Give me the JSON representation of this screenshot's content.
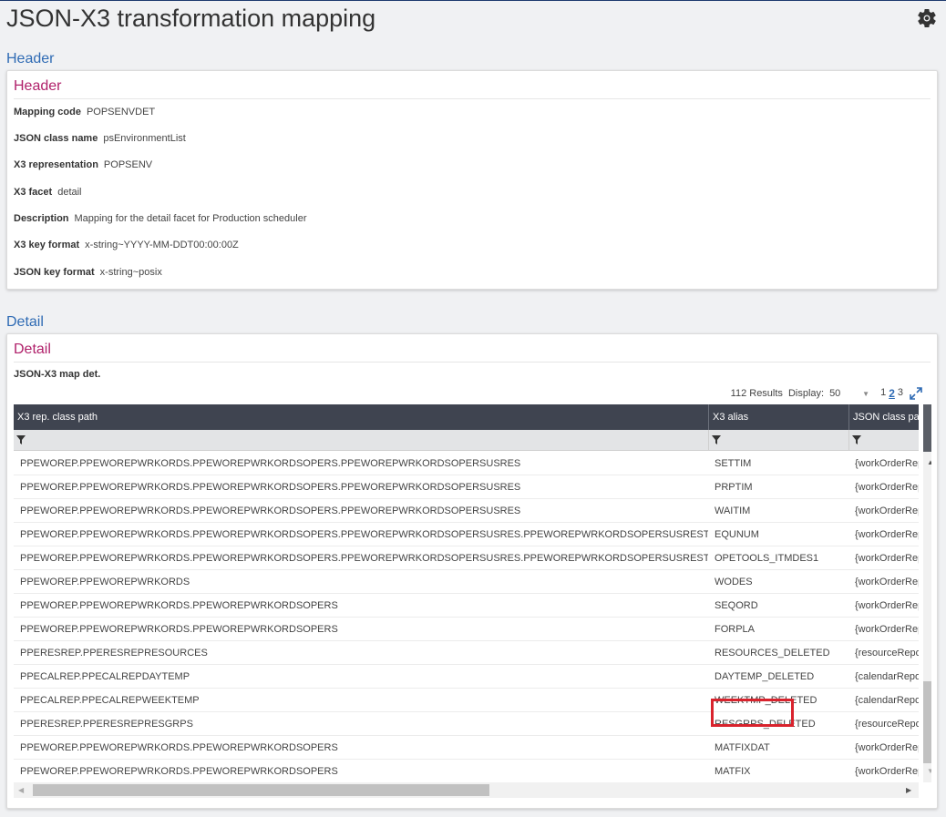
{
  "page": {
    "title": "JSON-X3 transformation mapping"
  },
  "header_section": {
    "link_label": "Header",
    "card_title": "Header",
    "fields": [
      {
        "label": "Mapping code",
        "value": "POPSENVDET"
      },
      {
        "label": "JSON class name",
        "value": "psEnvironmentList"
      },
      {
        "label": "X3 representation",
        "value": "POPSENV"
      },
      {
        "label": "X3 facet",
        "value": "detail"
      },
      {
        "label": "Description",
        "value": "Mapping for the detail facet for Production scheduler"
      },
      {
        "label": "X3 key format",
        "value": "x-string~YYYY-MM-DDT00:00:00Z"
      },
      {
        "label": "JSON key format",
        "value": "x-string~posix"
      }
    ]
  },
  "detail_section": {
    "link_label": "Detail",
    "card_title": "Detail",
    "table_title": "JSON-X3 map det.",
    "results_label": "112 Results",
    "display_label": "Display:",
    "display_value": "50",
    "pages": [
      "1",
      "2",
      "3"
    ],
    "active_page": "2",
    "columns": [
      "X3 rep. class path",
      "X3 alias",
      "JSON class path"
    ],
    "rows": [
      {
        "path": "PPEWOREP.PPEWOREPWRKORDS.PPEWOREPWRKORDSOPERS.PPEWOREPWRKORDSOPERSUSRES",
        "alias": "SETTIM",
        "json": "{workOrderReport}"
      },
      {
        "path": "PPEWOREP.PPEWOREPWRKORDS.PPEWOREPWRKORDSOPERS.PPEWOREPWRKORDSOPERSUSRES",
        "alias": "PRPTIM",
        "json": "{workOrderReport}"
      },
      {
        "path": "PPEWOREP.PPEWOREPWRKORDS.PPEWOREPWRKORDSOPERS.PPEWOREPWRKORDSOPERSUSRES",
        "alias": "WAITIM",
        "json": "{workOrderReport}"
      },
      {
        "path": "PPEWOREP.PPEWOREPWRKORDS.PPEWOREPWRKORDSOPERS.PPEWOREPWRKORDSOPERSUSRES.PPEWOREPWRKORDSOPERSUSRESTOOLS",
        "alias": "EQUNUM",
        "json": "{workOrderReport}"
      },
      {
        "path": "PPEWOREP.PPEWOREPWRKORDS.PPEWOREPWRKORDSOPERS.PPEWOREPWRKORDSOPERSUSRES.PPEWOREPWRKORDSOPERSUSRESTOOLS",
        "alias": "OPETOOLS_ITMDES1",
        "json": "{workOrderReport}"
      },
      {
        "path": "PPEWOREP.PPEWOREPWRKORDS",
        "alias": "WODES",
        "json": "{workOrderReport}"
      },
      {
        "path": "PPEWOREP.PPEWOREPWRKORDS.PPEWOREPWRKORDSOPERS",
        "alias": "SEQORD",
        "json": "{workOrderReport}"
      },
      {
        "path": "PPEWOREP.PPEWOREPWRKORDS.PPEWOREPWRKORDSOPERS",
        "alias": "FORPLA",
        "json": "{workOrderReport}"
      },
      {
        "path": "PPERESREP.PPERESREPRESOURCES",
        "alias": "RESOURCES_DELETED",
        "json": "{resourceReport}"
      },
      {
        "path": "PPECALREP.PPECALREPDAYTEMP",
        "alias": "DAYTEMP_DELETED",
        "json": "{calendarReport}"
      },
      {
        "path": "PPECALREP.PPECALREPWEEKTEMP",
        "alias": "WEEKTMP_DELETED",
        "json": "{calendarReport}"
      },
      {
        "path": "PPERESREP.PPERESREPRESGRPS",
        "alias": "RESGRPS_DELETED",
        "json": "{resourceReport}"
      },
      {
        "path": "PPEWOREP.PPEWOREPWRKORDS.PPEWOREPWRKORDSOPERS",
        "alias": "MATFIXDAT",
        "json": "{workOrderReport}"
      },
      {
        "path": "PPEWOREP.PPEWOREPWRKORDS.PPEWOREPWRKORDSOPERS",
        "alias": "MATFIX",
        "json": "{workOrderReport}"
      }
    ],
    "highlighted_alias": "MATFIXDAT"
  },
  "icons": {
    "settings": "gear-icon",
    "expand": "expand-icon",
    "filter": "filter-icon"
  },
  "colors": {
    "accent_link": "#2f6bb4",
    "card_title": "#b0206a",
    "table_header": "#3f4450",
    "highlight": "#d9232d"
  }
}
